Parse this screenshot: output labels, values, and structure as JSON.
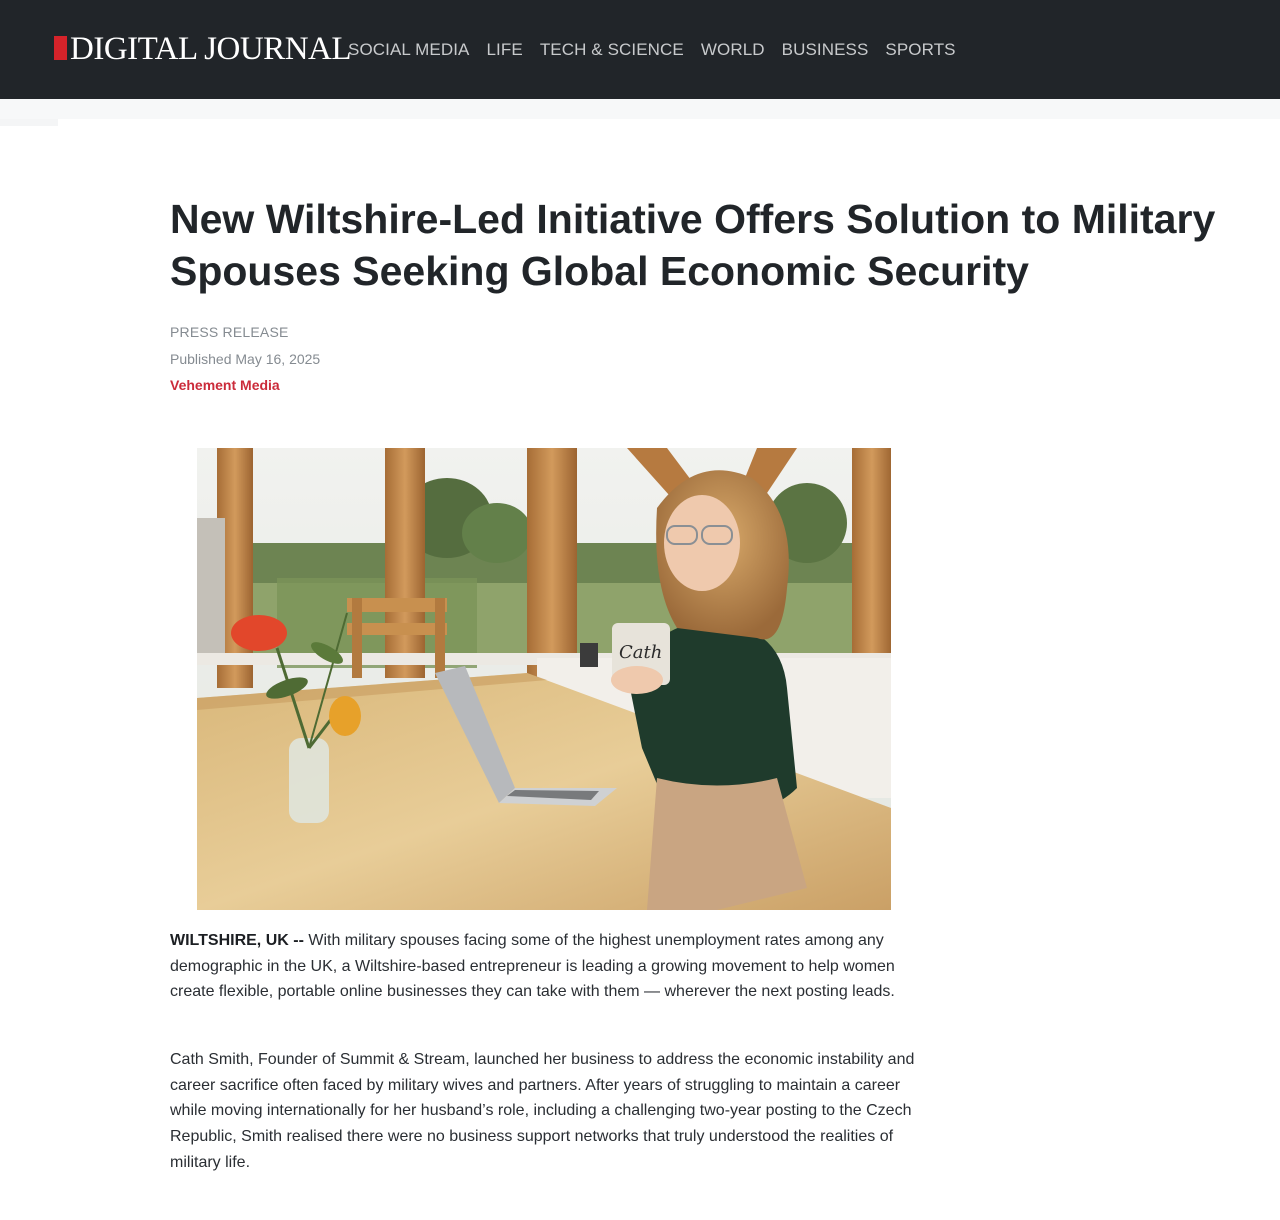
{
  "site": {
    "logo_text": "DIGITAL JOURNAL",
    "brand_color": "#d6232a",
    "header_bg": "#212529"
  },
  "nav": {
    "items": [
      "SOCIAL MEDIA",
      "LIFE",
      "TECH & SCIENCE",
      "WORLD",
      "BUSINESS",
      "SPORTS"
    ]
  },
  "article": {
    "title": "New Wiltshire-Led Initiative Offers Solution to Military Spouses Seeking Global Economic Security",
    "kind": "PRESS RELEASE",
    "published": "Published May 16, 2025",
    "author": "Vehement Media",
    "author_color": "#cb2b3a",
    "image": {
      "mug_text": "Cath"
    },
    "dateline": "WILTSHIRE, UK --",
    "paragraph_1": " With military spouses facing some of the highest unemployment rates among any demographic in the UK, a Wiltshire-based entrepreneur is leading a growing movement to help women create flexible, portable online businesses they can take with them — wherever the next posting leads.",
    "paragraph_2": "Cath Smith, Founder of Summit & Stream, launched her business to address the economic instability and career sacrifice often faced by military wives and partners. After years of struggling to maintain a career while moving internationally for her husband’s role, including a challenging two-year posting to the Czech Republic, Smith realised there were no business support networks that truly understood the realities of military life."
  }
}
